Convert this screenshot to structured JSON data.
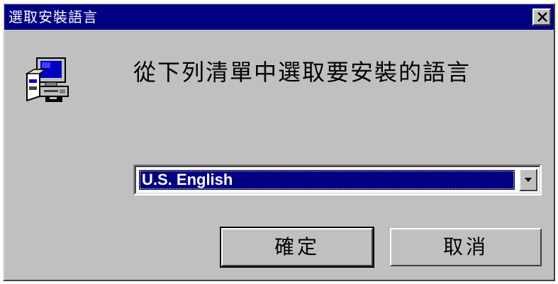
{
  "window": {
    "title": "選取安裝語言",
    "close_icon": "close-icon"
  },
  "dialog": {
    "prompt": "從下列清單中選取要安裝的語言",
    "icon": "computer-setup-icon"
  },
  "language_select": {
    "selected": "U.S. English",
    "arrow_icon": "chevron-down-icon"
  },
  "buttons": {
    "ok_label": "確定",
    "cancel_label": "取消"
  },
  "colors": {
    "titlebar": "#000080",
    "face": "#c0c0c0",
    "selection": "#000080"
  }
}
